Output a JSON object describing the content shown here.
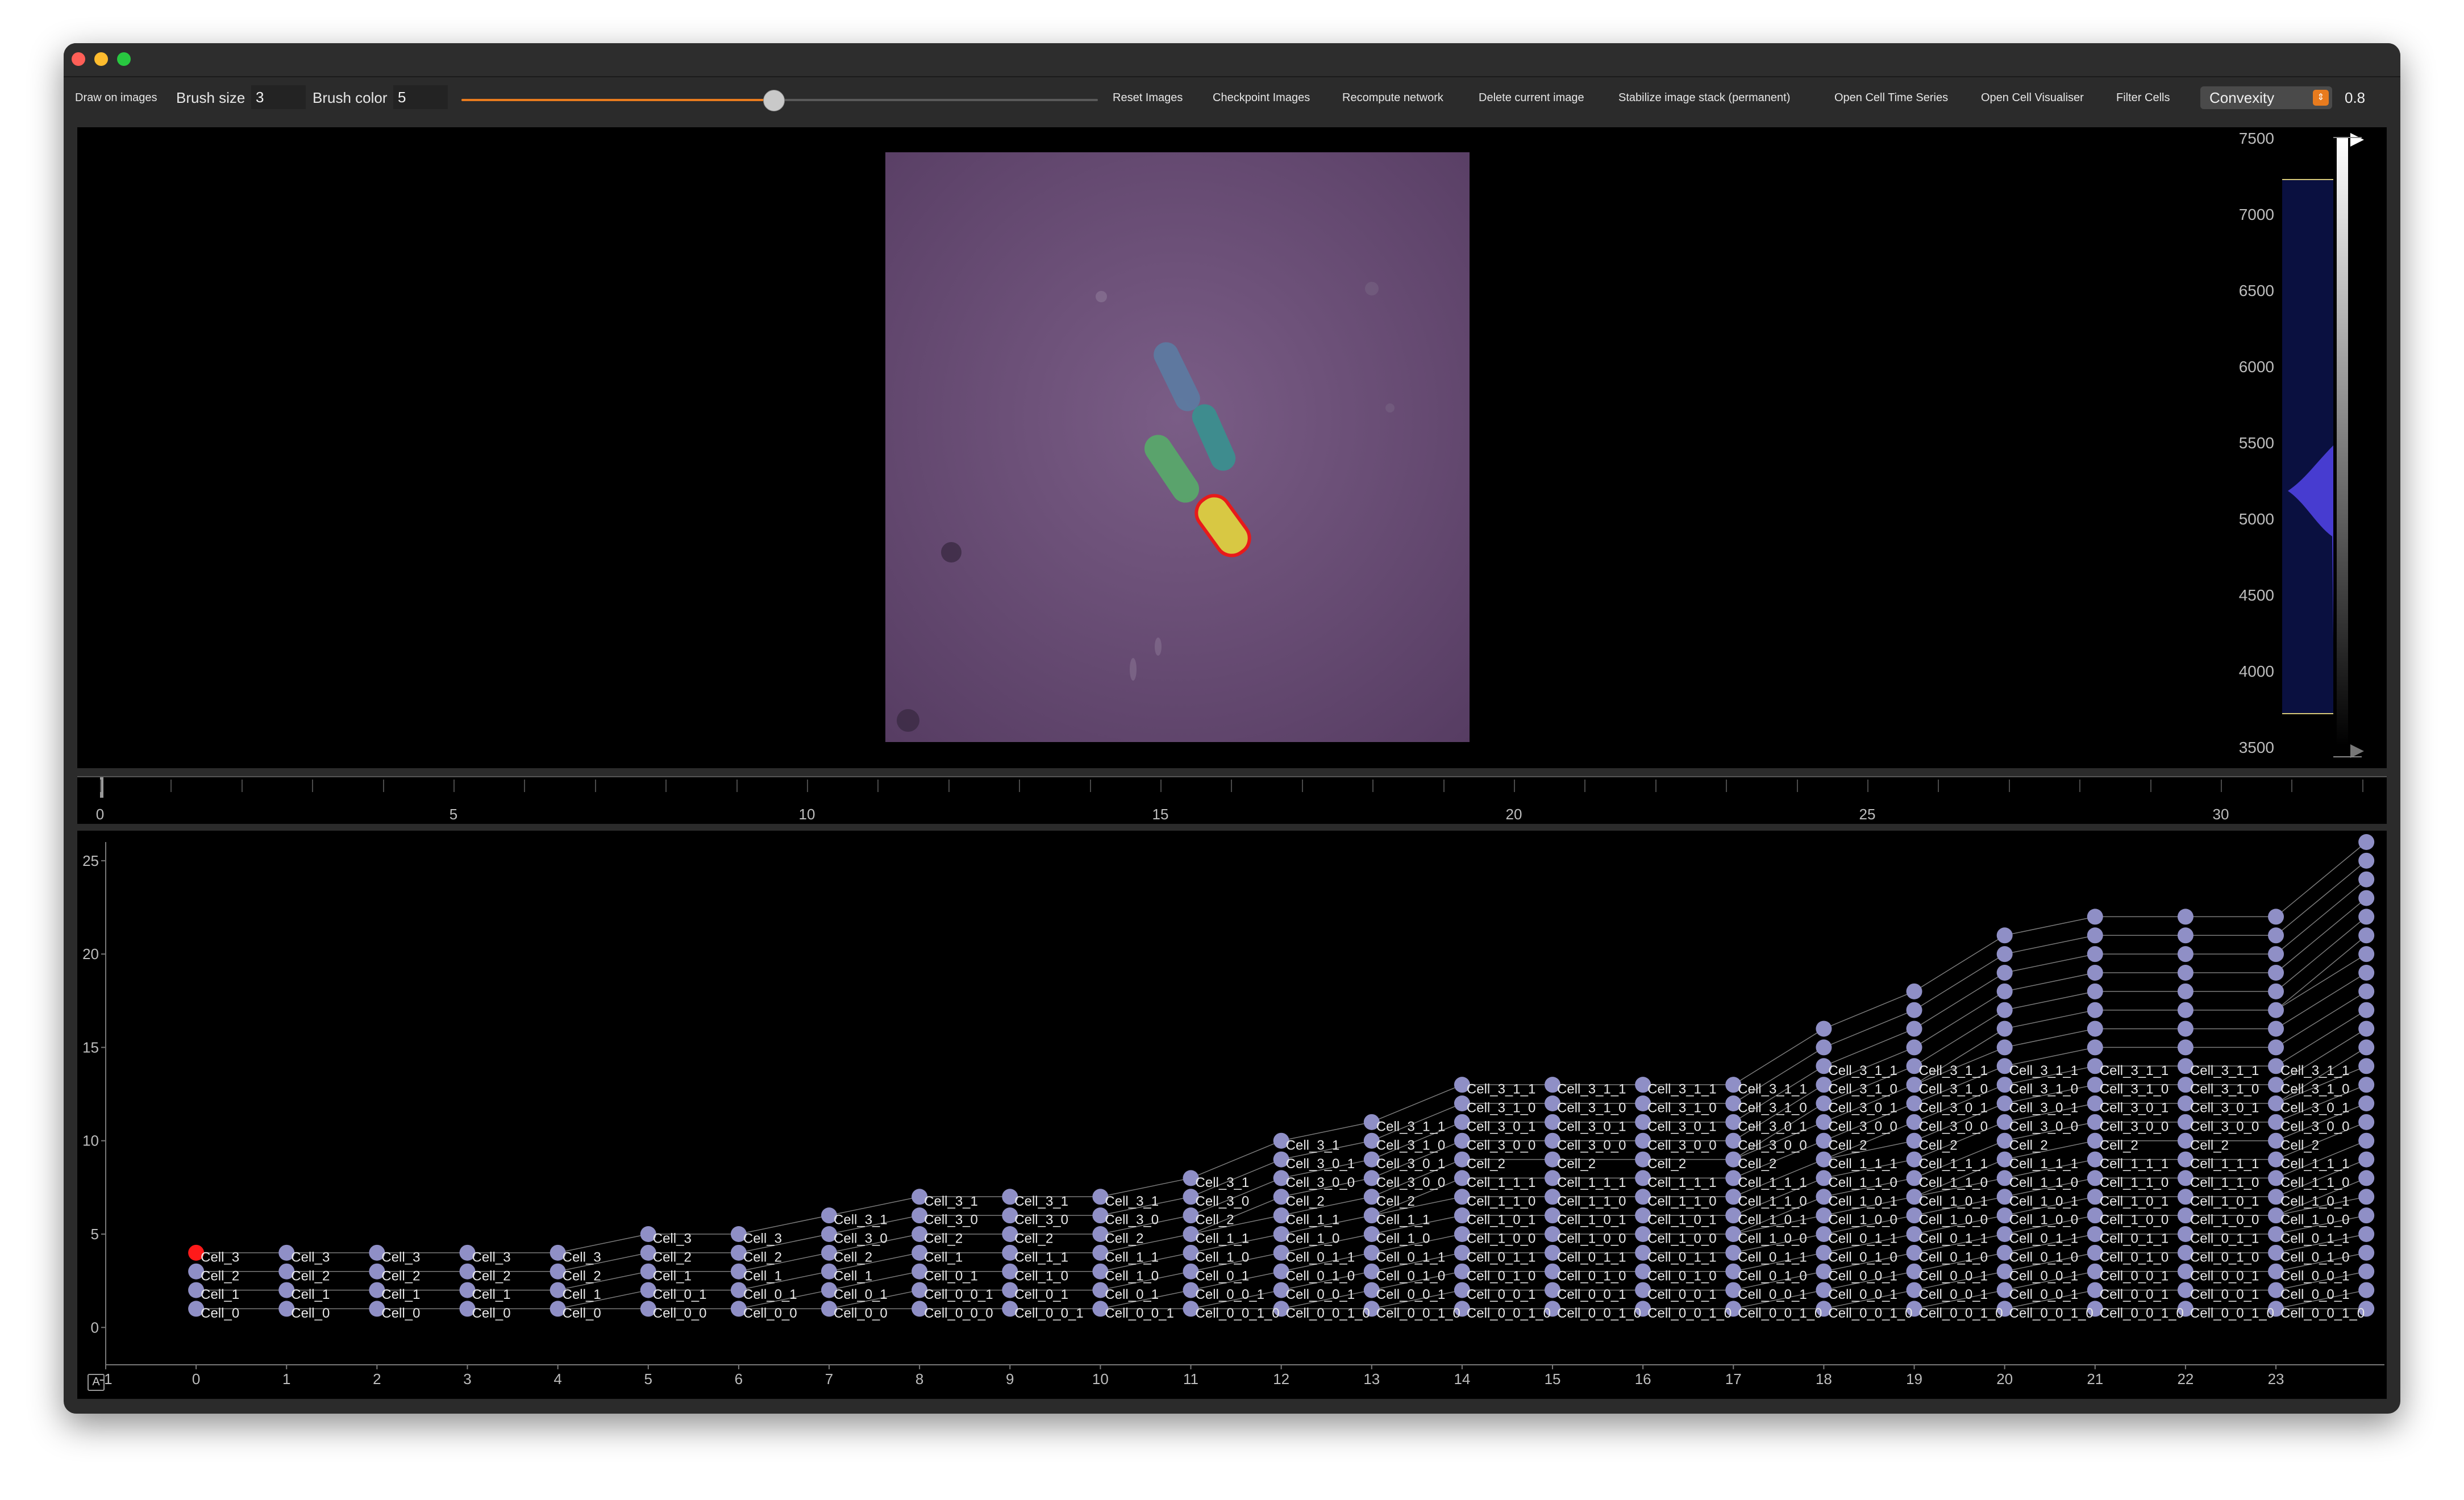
{
  "toolbar": {
    "draw_on_images": "Draw on images",
    "brush_size_label": "Brush size",
    "brush_size_value": "3",
    "brush_color_label": "Brush color",
    "brush_color_value": "5",
    "slider_value_fraction": 0.49,
    "buttons": [
      "Reset Images",
      "Checkpoint Images",
      "Recompute network",
      "Delete current image",
      "Stabilize image stack (permanent)",
      "Open Cell Time Series",
      "Open Cell Visualiser",
      "Filter Cells"
    ],
    "metric_select": "Convexity",
    "metric_value": "0.8"
  },
  "histogram": {
    "ticks": [
      "7500",
      "7000",
      "6500",
      "6000",
      "5500",
      "5000",
      "4500",
      "4000",
      "3500"
    ],
    "colors": {
      "gradient_top": "#ffffff",
      "gradient_bottom": "#000000",
      "fill": "#4b3fd8"
    }
  },
  "timeline": {
    "ticks": [
      "0",
      "5",
      "10",
      "15",
      "20",
      "25",
      "30"
    ]
  },
  "chart_data": {
    "type": "scatter",
    "title": "",
    "xlabel": "",
    "ylabel": "",
    "xlim": [
      -1,
      24.2
    ],
    "ylim": [
      -2,
      26
    ],
    "x_ticks": [
      "-1",
      "0",
      "1",
      "2",
      "3",
      "4",
      "5",
      "6",
      "7",
      "8",
      "9",
      "10",
      "11",
      "12",
      "13",
      "14",
      "15",
      "16",
      "17",
      "18",
      "19",
      "20",
      "21",
      "22",
      "23"
    ],
    "y_ticks": [
      "0",
      "5",
      "10",
      "15",
      "20",
      "25"
    ],
    "selected_node": {
      "x": 0,
      "y": 4,
      "color": "#ff1a1a"
    },
    "node_color": "#8f8fc6",
    "columns": [
      {
        "x": 0,
        "labels": [
          "Cell_3",
          "Cell_2",
          "Cell_1",
          "Cell_0"
        ]
      },
      {
        "x": 1,
        "labels": [
          "Cell_3",
          "Cell_2",
          "Cell_1",
          "Cell_0"
        ]
      },
      {
        "x": 2,
        "labels": [
          "Cell_3",
          "Cell_2",
          "Cell_1",
          "Cell_0"
        ]
      },
      {
        "x": 3,
        "labels": [
          "Cell_3",
          "Cell_2",
          "Cell_1",
          "Cell_0"
        ]
      },
      {
        "x": 4,
        "labels": [
          "Cell_3",
          "Cell_2",
          "Cell_1",
          "Cell_0"
        ]
      },
      {
        "x": 5,
        "labels": [
          "Cell_3",
          "Cell_2",
          "Cell_1",
          "Cell_0_1",
          "Cell_0_0"
        ]
      },
      {
        "x": 6,
        "labels": [
          "Cell_3",
          "Cell_2",
          "Cell_1",
          "Cell_0_1",
          "Cell_0_0"
        ]
      },
      {
        "x": 7,
        "labels": [
          "Cell_3_1",
          "Cell_3_0",
          "Cell_2",
          "Cell_1",
          "Cell_0_1",
          "Cell_0_0"
        ]
      },
      {
        "x": 8,
        "labels": [
          "Cell_3_1",
          "Cell_3_0",
          "Cell_2",
          "Cell_1",
          "Cell_0_1",
          "Cell_0_0_1",
          "Cell_0_0_0"
        ]
      },
      {
        "x": 9,
        "labels": [
          "Cell_3_1",
          "Cell_3_0",
          "Cell_2",
          "Cell_1_1",
          "Cell_1_0",
          "Cell_0_1",
          "Cell_0_0_1"
        ]
      },
      {
        "x": 10,
        "labels": [
          "Cell_3_1",
          "Cell_3_0",
          "Cell_2",
          "Cell_1_1",
          "Cell_1_0",
          "Cell_0_1",
          "Cell_0_0_1"
        ]
      },
      {
        "x": 11,
        "labels": [
          "Cell_3_1",
          "Cell_3_0",
          "Cell_2",
          "Cell_1_1",
          "Cell_1_0",
          "Cell_0_1",
          "Cell_0_0_1",
          "Cell_0_0_1_0"
        ]
      },
      {
        "x": 12,
        "labels": [
          "Cell_3_1",
          "Cell_3_0_1",
          "Cell_3_0_0",
          "Cell_2",
          "Cell_1_1",
          "Cell_1_0",
          "Cell_0_1_1",
          "Cell_0_1_0",
          "Cell_0_0_1",
          "Cell_0_0_1_0"
        ]
      },
      {
        "x": 13,
        "labels": [
          "Cell_3_1_1",
          "Cell_3_1_0",
          "Cell_3_0_1",
          "Cell_3_0_0",
          "Cell_2",
          "Cell_1_1",
          "Cell_1_0",
          "Cell_0_1_1",
          "Cell_0_1_0",
          "Cell_0_0_1",
          "Cell_0_0_1_0"
        ]
      },
      {
        "x": 14,
        "labels": [
          "Cell_3_1_1",
          "Cell_3_1_0",
          "Cell_3_0_1",
          "Cell_3_0_0",
          "Cell_2",
          "Cell_1_1_1",
          "Cell_1_1_0",
          "Cell_1_0_1",
          "Cell_1_0_0",
          "Cell_0_1_1",
          "Cell_0_1_0",
          "Cell_0_0_1",
          "Cell_0_0_1_0"
        ]
      },
      {
        "x": 15,
        "labels": [
          "Cell_3_1_1",
          "Cell_3_1_0",
          "Cell_3_0_1",
          "Cell_3_0_0",
          "Cell_2",
          "Cell_1_1_1",
          "Cell_1_1_0",
          "Cell_1_0_1",
          "Cell_1_0_0",
          "Cell_0_1_1",
          "Cell_0_1_0",
          "Cell_0_0_1",
          "Cell_0_0_1_0"
        ]
      },
      {
        "x": 16,
        "labels": [
          "Cell_3_1_1",
          "Cell_3_1_0",
          "Cell_3_0_1",
          "Cell_3_0_0",
          "Cell_2",
          "Cell_1_1_1",
          "Cell_1_1_0",
          "Cell_1_0_1",
          "Cell_1_0_0",
          "Cell_0_1_1",
          "Cell_0_1_0",
          "Cell_0_0_1",
          "Cell_0_0_1_0"
        ]
      },
      {
        "x": 17,
        "labels": [
          "Cell_3_1_1",
          "Cell_3_1_0",
          "Cell_3_0_1",
          "Cell_3_0_0",
          "Cell_2",
          "Cell_1_1_1",
          "Cell_1_1_0",
          "Cell_1_0_1",
          "Cell_1_0_0",
          "Cell_0_1_1",
          "Cell_0_1_0",
          "Cell_0_0_1",
          "Cell_0_0_1_0"
        ]
      },
      {
        "x": 18,
        "labels": [
          "Cell_3_1_1",
          "Cell_3_1_0",
          "Cell_3_0_1",
          "Cell_3_0_0",
          "Cell_2",
          "Cell_1_1_1",
          "Cell_1_1_0",
          "Cell_1_0_1",
          "Cell_1_0_0",
          "Cell_0_1_1",
          "Cell_0_1_0",
          "Cell_0_0_1",
          "Cell_0_0_1",
          "Cell_0_0_1_0"
        ]
      },
      {
        "x": 19,
        "labels": [
          "Cell_3_1_1",
          "Cell_3_1_0",
          "Cell_3_0_1",
          "Cell_3_0_0",
          "Cell_2",
          "Cell_1_1_1",
          "Cell_1_1_0",
          "Cell_1_0_1",
          "Cell_1_0_0",
          "Cell_0_1_1",
          "Cell_0_1_0",
          "Cell_0_0_1",
          "Cell_0_0_1",
          "Cell_0_0_1_0"
        ]
      },
      {
        "x": 20,
        "labels": [
          "Cell_3_1_1",
          "Cell_3_1_0",
          "Cell_3_0_1",
          "Cell_3_0_0",
          "Cell_2",
          "Cell_1_1_1",
          "Cell_1_1_0",
          "Cell_1_0_1",
          "Cell_1_0_0",
          "Cell_0_1_1",
          "Cell_0_1_0",
          "Cell_0_0_1",
          "Cell_0_0_1",
          "Cell_0_0_1_0"
        ]
      },
      {
        "x": 21,
        "labels": [
          "Cell_3_1_1",
          "Cell_3_1_0",
          "Cell_3_0_1",
          "Cell_3_0_0",
          "Cell_2",
          "Cell_1_1_1",
          "Cell_1_1_0",
          "Cell_1_0_1",
          "Cell_1_0_0",
          "Cell_0_1_1",
          "Cell_0_1_0",
          "Cell_0_0_1",
          "Cell_0_0_1",
          "Cell_0_0_1_0"
        ]
      },
      {
        "x": 22,
        "labels": [
          "Cell_3_1_1",
          "Cell_3_1_0",
          "Cell_3_0_1",
          "Cell_3_0_0",
          "Cell_2",
          "Cell_1_1_1",
          "Cell_1_1_0",
          "Cell_1_0_1",
          "Cell_1_0_0",
          "Cell_0_1_1",
          "Cell_0_1_0",
          "Cell_0_0_1",
          "Cell_0_0_1",
          "Cell_0_0_1_0"
        ]
      },
      {
        "x": 23,
        "labels": [
          "Cell_3_1_1",
          "Cell_3_1_0",
          "Cell_3_0_1",
          "Cell_3_0_0",
          "Cell_2",
          "Cell_1_1_1",
          "Cell_1_1_0",
          "Cell_1_0_1",
          "Cell_1_0_0",
          "Cell_0_1_1",
          "Cell_0_1_0",
          "Cell_0_0_1",
          "Cell_0_0_1",
          "Cell_0_0_1_0"
        ]
      }
    ],
    "node_counts": [
      4,
      4,
      4,
      4,
      4,
      5,
      5,
      6,
      7,
      7,
      7,
      8,
      10,
      11,
      13,
      13,
      13,
      13,
      16,
      18,
      21,
      22,
      22,
      22,
      26
    ]
  }
}
